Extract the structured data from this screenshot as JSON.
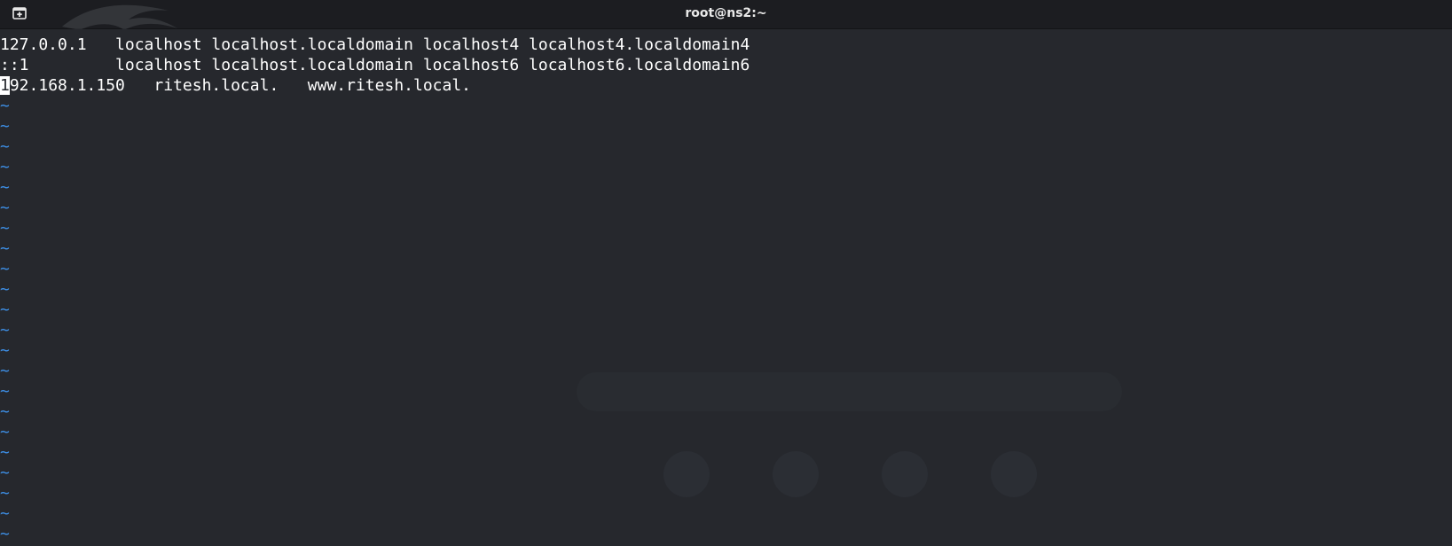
{
  "window": {
    "title": "root@ns2:~"
  },
  "icons": {
    "new_tab": "new-tab-icon",
    "logo": "kali-dragon-icon"
  },
  "colors": {
    "background": "#26282d",
    "titlebar": "#1c1d21",
    "text": "#ffffff",
    "tilde": "#3d8fe6"
  },
  "editor": {
    "lines": [
      "127.0.0.1   localhost localhost.localdomain localhost4 localhost4.localdomain4",
      "::1         localhost localhost.localdomain localhost6 localhost6.localdomain6"
    ],
    "cursor_line": {
      "cursor_char": "1",
      "rest": "92.168.1.150   ritesh.local.   www.ritesh.local."
    },
    "empty_line_marker": "~",
    "empty_line_count": 22
  }
}
